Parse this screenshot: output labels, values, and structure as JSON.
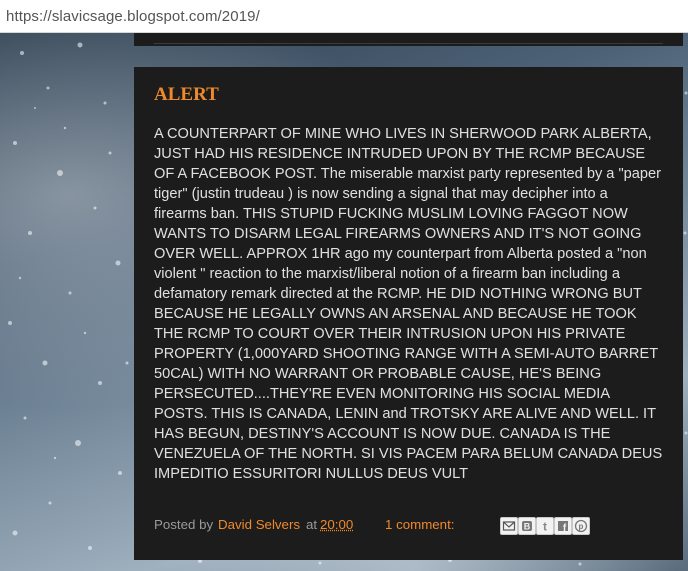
{
  "browser": {
    "url": "https://slavicsage.blogspot.com/2019/"
  },
  "post": {
    "title": "ALERT",
    "body": "A COUNTERPART OF MINE WHO LIVES IN SHERWOOD PARK ALBERTA, JUST HAD HIS RESIDENCE INTRUDED UPON BY THE RCMP BECAUSE OF A FACEBOOK POST. The miserable marxist party represented by a \"paper tiger\" (justin trudeau ) is now sending a signal that may decipher into a firearms ban. THIS STUPID FUCKING MUSLIM LOVING FAGGOT NOW WANTS TO DISARM LEGAL FIREARMS OWNERS AND IT'S NOT GOING OVER WELL. APPROX 1HR ago my counterpart from Alberta posted a \"non violent \" reaction to the marxist/liberal notion of a firearm ban including a defamatory remark directed at the RCMP. HE DID NOTHING WRONG BUT BECAUSE HE LEGALLY OWNS AN ARSENAL AND BECAUSE HE TOOK THE RCMP TO COURT OVER THEIR INTRUSION UPON HIS PRIVATE PROPERTY (1,000YARD SHOOTING RANGE WITH A SEMI-AUTO BARRET 50CAL) WITH NO WARRANT OR PROBABLE CAUSE, HE'S BEING PERSECUTED....THEY'RE EVEN MONITORING HIS SOCIAL MEDIA POSTS. THIS IS CANADA, LENIN and TROTSKY ARE ALIVE AND WELL. IT HAS BEGUN, DESTINY'S ACCOUNT IS NOW DUE. CANADA IS THE VENEZUELA OF THE NORTH. SI VIS PACEM PARA BELUM CANADA DEUS IMPEDITIO ESSURITORI NULLUS DEUS VULT",
    "footer": {
      "posted_by_label": "Posted by",
      "author": "David Selvers",
      "at_label": "at",
      "time": "20:00",
      "comments": "1 comment:"
    },
    "share_icons": [
      "email-icon",
      "blogger-icon",
      "twitter-icon",
      "facebook-icon",
      "pinterest-icon"
    ]
  },
  "colors": {
    "accent": "#f0892b",
    "post_bg": "#1c1c1c",
    "body_text": "#e0e0e0",
    "meta_text": "#9a9a9a"
  }
}
